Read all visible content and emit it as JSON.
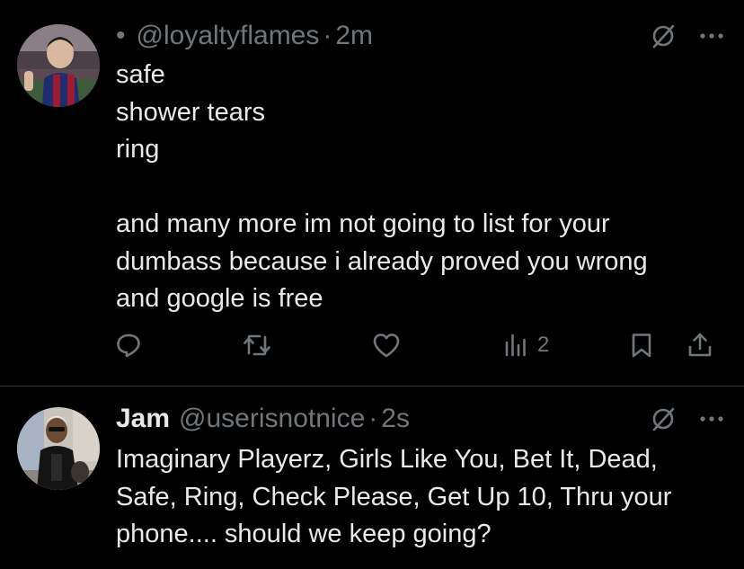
{
  "tweets": [
    {
      "display_name": "",
      "handle": "@loyaltyflames",
      "separator": "·",
      "time": "2m",
      "lines": [
        "safe",
        "shower tears",
        "ring",
        "",
        "and many more im not going to list for your",
        "dumbass because i already proved you wrong",
        "and google is free"
      ],
      "views": "2"
    },
    {
      "display_name": "Jam",
      "handle": "@userisnotnice",
      "separator": "·",
      "time": "2s",
      "lines": [
        "Imaginary Playerz, Girls Like You, Bet It, Dead,",
        "Safe, Ring, Check Please, Get Up 10, Thru your",
        "phone.... should we keep going?"
      ]
    }
  ],
  "icons": {
    "reply": "reply-icon",
    "repost": "repost-icon",
    "like": "like-icon",
    "views": "views-icon",
    "bookmark": "bookmark-icon",
    "share": "share-icon",
    "grok": "grok-icon",
    "more": "more-icon"
  },
  "colors": {
    "background": "#000000",
    "text": "#e7e9ea",
    "secondary": "#71767b",
    "divider": "#2f3336"
  }
}
